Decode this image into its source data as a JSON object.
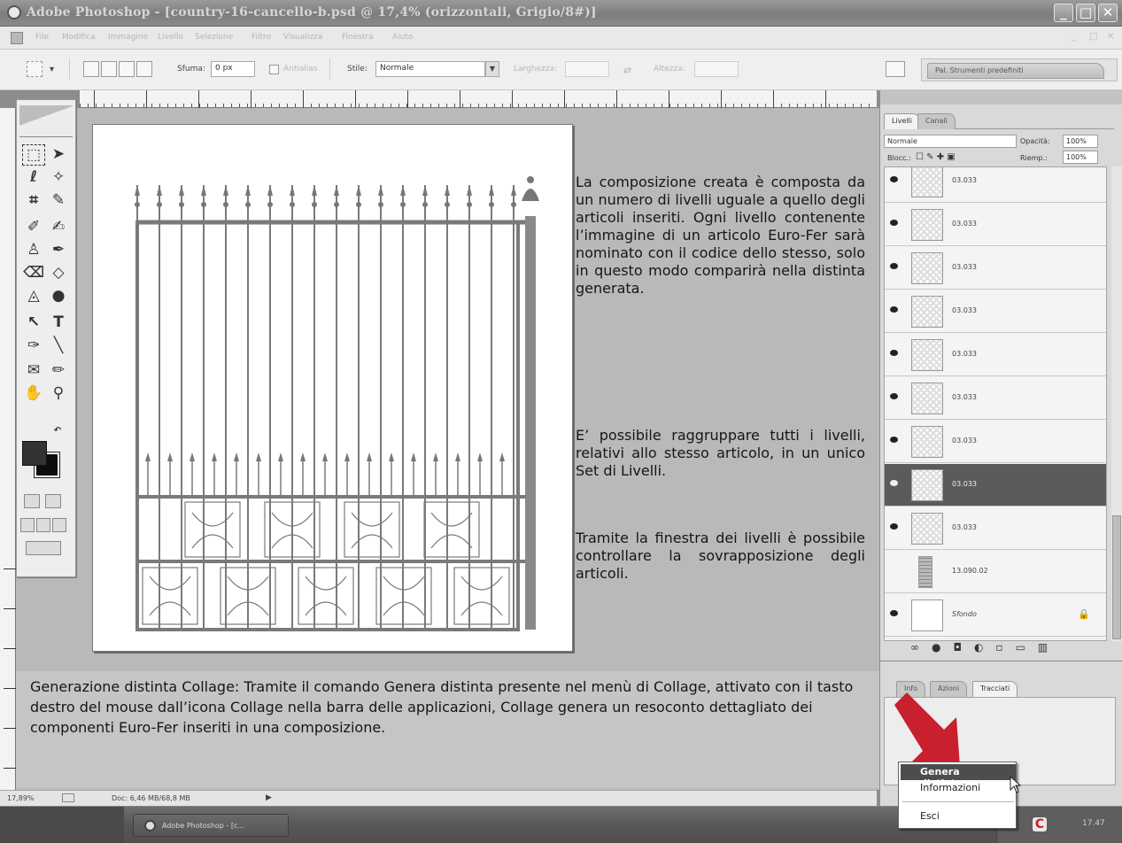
{
  "window": {
    "title": "Adobe Photoshop - [country-16-cancello-b.psd @ 17,4% (orizzontali, Grigio/8#)]",
    "controls": [
      "_",
      "□",
      "✕"
    ]
  },
  "menu": {
    "items": [
      "File",
      "Modifica",
      "Immagine",
      "Livello",
      "Selezione",
      "Filtro",
      "Visualizza",
      "Finestra",
      "Aiuto"
    ],
    "mdi_controls": [
      "_",
      "□",
      "✕"
    ]
  },
  "options": {
    "sfuma_label": "Sfuma:",
    "sfuma_value": "0 px",
    "antialias_label": "Antialias",
    "stile_label": "Stile:",
    "stile_value": "Normale",
    "larghezza_label": "Larghezza:",
    "altezza_label": "Altezza:",
    "palette_tab": "Pal. Strumenti predefiniti"
  },
  "explain": {
    "p1": "La composizione creata è composta da un numero di livelli uguale a quello degli articoli inseriti. Ogni livello contenente l’immagine di un articolo Euro-Fer sarà nominato con il codice dello stesso, solo in questo modo comparirà nella distinta generata.",
    "p2": "E’ possibile raggruppare tutti i livelli, relativi allo stesso articolo, in un unico Set di Livelli.",
    "p3": "Tramite la finestra dei livelli è possibile controllare la sovrapposizione degli articoli.",
    "bottom": "Generazione distinta Collage: Tramite il comando Genera distinta presente nel menù di Collage, attivato con il tasto destro del mouse dall’icona Collage nella barra delle applicazioni, Collage genera un resoconto dettagliato dei componenti Euro-Fer inseriti in una composizione."
  },
  "status": {
    "zoom": "17,89%",
    "doc": "Doc: 6,46 MB/68,8 MB"
  },
  "layers_panel": {
    "tabs": [
      "Livelli",
      "Canali"
    ],
    "blend_mode": "Normale",
    "opacity_label": "Opacità:",
    "opacity_value": "100%",
    "lock_label": "Blocc.:",
    "fill_label": "Riemp.:",
    "fill_value": "100%",
    "layers": [
      {
        "name": "03.033",
        "selected": false
      },
      {
        "name": "03.033",
        "selected": false
      },
      {
        "name": "03.033",
        "selected": false
      },
      {
        "name": "03.033",
        "selected": false
      },
      {
        "name": "03.033",
        "selected": false
      },
      {
        "name": "03.033",
        "selected": false
      },
      {
        "name": "03.033",
        "selected": false
      },
      {
        "name": "03.033",
        "selected": true
      },
      {
        "name": "03.033",
        "selected": false
      },
      {
        "name": "13.090.02",
        "selected": false
      },
      {
        "name": "Sfondo",
        "selected": false
      }
    ]
  },
  "paths_panel": {
    "tabs": [
      "Info",
      "Azioni",
      "Tracciati"
    ]
  },
  "context_menu": {
    "items": [
      "Genera distinta",
      "Informazioni",
      "Esci"
    ]
  },
  "taskbar": {
    "task_label": "Adobe Photoshop - [c...",
    "tray_icon": "C",
    "clock": "17.47"
  },
  "colors": {
    "arrow": "#c8202d",
    "selected_layer": "#5b5b5b",
    "highlight": "#4d4d4d"
  }
}
